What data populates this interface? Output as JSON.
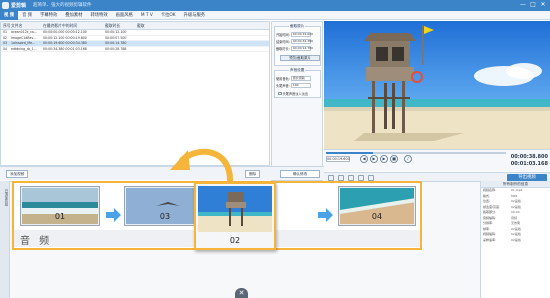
{
  "app": {
    "title": "爱剪辑",
    "subtitle": "超简单、强大的视频剪辑软件",
    "window_buttons": [
      "—",
      "□",
      "✕"
    ]
  },
  "menu": {
    "tabs": [
      "视 频",
      "音 频",
      "字幕特效",
      "叠加素材",
      "转场特效",
      "画面风格",
      "M T V",
      "卡拉OK",
      "升级与服务"
    ]
  },
  "filelist": {
    "headers": [
      "序号",
      "文件名",
      "在最终影片中的时间",
      "截取时长",
      "截取"
    ],
    "rows": [
      [
        "01",
        "ocean012c_ca...",
        "00:00:00.000  00:00:12.100",
        "00:00:12.100",
        ""
      ],
      [
        "02",
        "ImageC1dRav...",
        "00:00:12.100  00:00:19.600",
        "00:00:07.500",
        ""
      ],
      [
        "03",
        "1oInspird_Me...",
        "00:00:19.600  00:00:34.380",
        "00:00:14.780",
        ""
      ],
      [
        "04",
        "edtdning_rb_1...",
        "00:00:34.380  00:01:03.168",
        "00:00:28.788",
        ""
      ]
    ],
    "selected_row": 2
  },
  "settings": {
    "clip_group_title": "截取原片",
    "start_label": "开始时间:",
    "start_value": "00:00:19.600",
    "end_label": "结束时间:",
    "end_value": "00:00:34.380",
    "dur_label": "截取时长:",
    "dur_value": "00:00:14.780",
    "preview_btn": "预览/截取原片",
    "audio_group_title": "声音设置",
    "mode_label": "使用音轨:",
    "mode_value": "原片音轨",
    "volume_label": "头尾声音:",
    "volume_value": "100",
    "mute_label": "头尾声音淡入淡出",
    "confirm_btn": "确认修改"
  },
  "toolbar": {
    "add_label": "添加视频",
    "delete_label": "删除"
  },
  "player": {
    "time_box": "00:00:19.600",
    "current_time": "00:00:38.800",
    "total_time": "00:01:03.168",
    "progress": 0.26
  },
  "strip": {
    "export_label": "导出视频"
  },
  "timeline": {
    "side_label": "已添加片段",
    "audio_label": "音 频",
    "clips": [
      {
        "num": "01"
      },
      {
        "num": "03"
      },
      {
        "num": "04"
      }
    ],
    "dragged_clip": {
      "num": "02"
    }
  },
  "props": {
    "title": "所有制作的信息",
    "rows": [
      [
        "视频名称:",
        "01.mp4"
      ],
      [
        "格式:",
        "MP4"
      ],
      [
        "位置:",
        "02画格"
      ],
      [
        "帧宽度/高度:",
        "02画格"
      ],
      [
        "截取部分:",
        "00:00"
      ],
      [
        "音频编码:",
        "音频"
      ],
      [
        "分辨率:",
        "无效果"
      ],
      [
        "帧率:",
        "02画格"
      ],
      [
        "视频编码:",
        "02画格"
      ],
      [
        "采样速率:",
        "02画格"
      ]
    ]
  }
}
